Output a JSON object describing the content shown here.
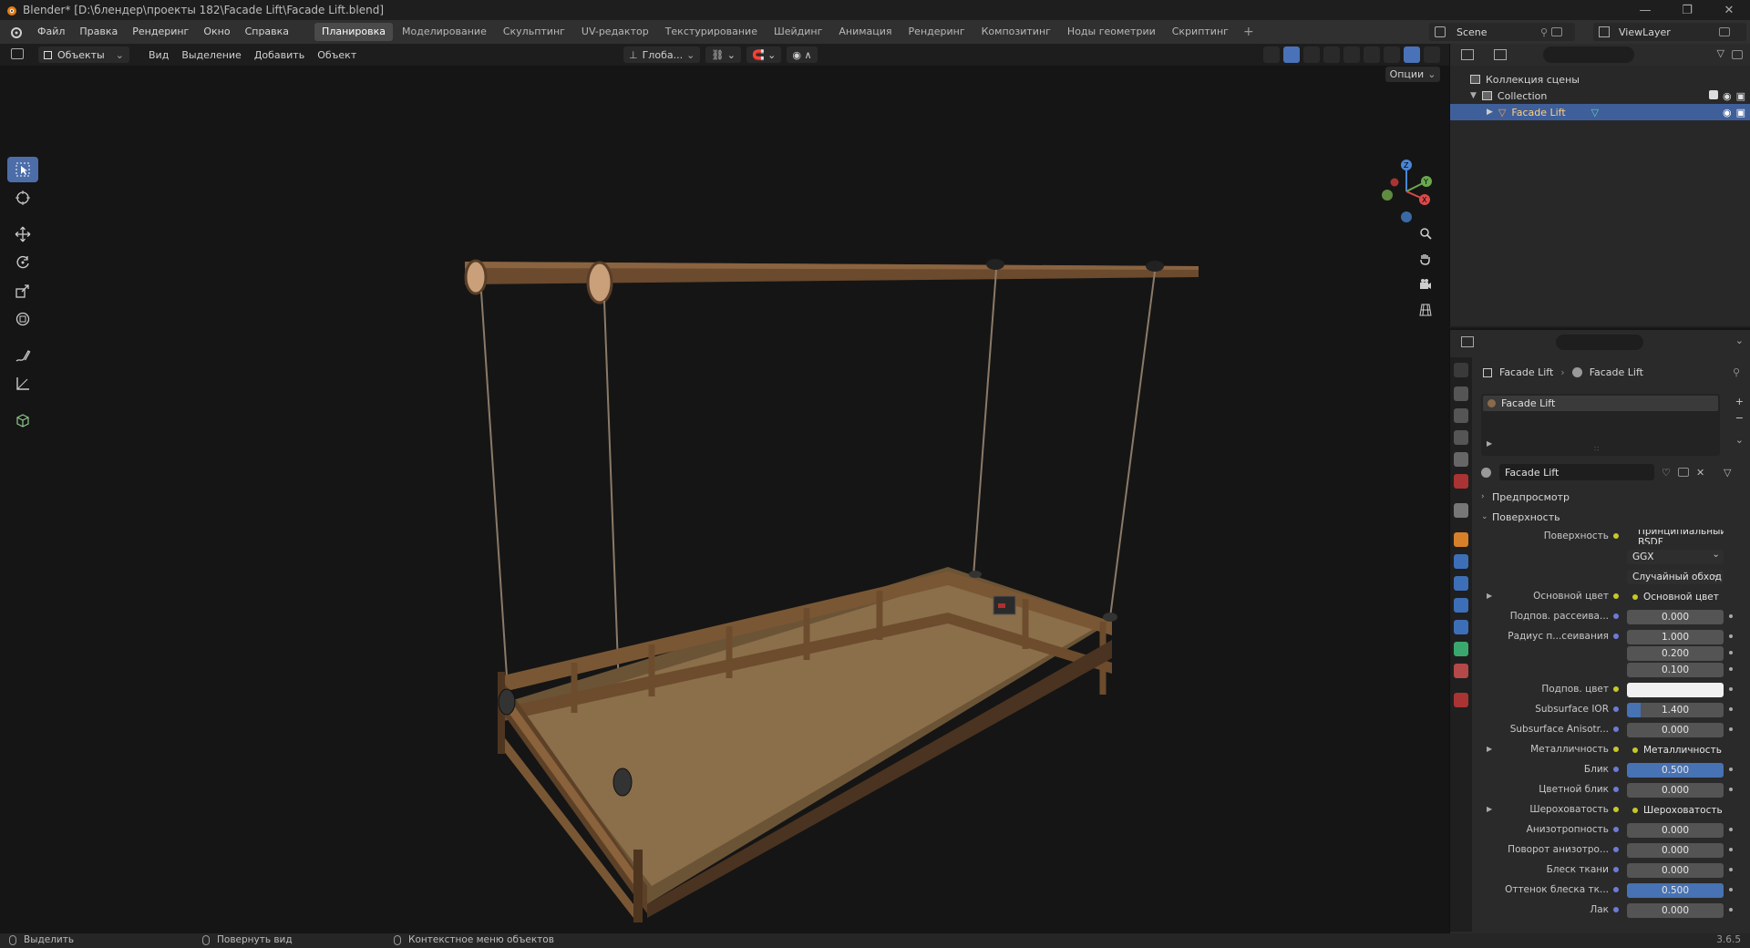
{
  "window": {
    "title": "Blender* [D:\\блендер\\проекты 182\\Facade Lift\\Facade Lift.blend]"
  },
  "menu": {
    "items": [
      "Файл",
      "Правка",
      "Рендеринг",
      "Окно",
      "Справка"
    ],
    "workspaces": [
      "Планировка",
      "Моделирование",
      "Скульптинг",
      "UV-редактор",
      "Текстурирование",
      "Шейдинг",
      "Анимация",
      "Рендеринг",
      "Композитинг",
      "Ноды геометрии",
      "Скриптинг"
    ],
    "active_workspace": "Планировка",
    "add_workspace": "+",
    "scene": "Scene",
    "view_layer": "ViewLayer"
  },
  "viewport_header": {
    "mode": "Объекты",
    "menus": [
      "Вид",
      "Выделение",
      "Добавить",
      "Объект"
    ],
    "transform_orientation": "Глоба...",
    "options": "Опции"
  },
  "outliner": {
    "root": "Коллекция сцены",
    "collection": "Collection",
    "object": "Facade Lift"
  },
  "properties": {
    "breadcrumb_object": "Facade Lift",
    "breadcrumb_material": "Facade Lift",
    "slot": "Facade Lift",
    "material_name": "Facade Lift",
    "panels": {
      "preview": "Предпросмотр",
      "surface": "Поверхность"
    },
    "rows": [
      {
        "label": "Поверхность",
        "value": "Принципиальный BSDF",
        "kind": "link"
      },
      {
        "label": "",
        "value": "GGX",
        "kind": "select"
      },
      {
        "label": "",
        "value": "Случайный обход",
        "kind": "select"
      },
      {
        "label": "Основной цвет",
        "value": "Основной цвет",
        "kind": "link",
        "expand": true
      },
      {
        "label": "Подпов. рассеива...",
        "value": "0.000",
        "kind": "num"
      },
      {
        "label": "Радиус п...сеивания",
        "value": "1.000",
        "kind": "num"
      },
      {
        "label": "",
        "value": "0.200",
        "kind": "num"
      },
      {
        "label": "",
        "value": "0.100",
        "kind": "num"
      },
      {
        "label": "Подпов. цвет",
        "value": "",
        "kind": "white"
      },
      {
        "label": "Subsurface IOR",
        "value": "1.400",
        "kind": "partial"
      },
      {
        "label": "Subsurface Anisotr...",
        "value": "0.000",
        "kind": "num"
      },
      {
        "label": "Металличность",
        "value": "Металличность",
        "kind": "link",
        "expand": true
      },
      {
        "label": "Блик",
        "value": "0.500",
        "kind": "blue"
      },
      {
        "label": "Цветной блик",
        "value": "0.000",
        "kind": "num"
      },
      {
        "label": "Шероховатость",
        "value": "Шероховатость",
        "kind": "link",
        "expand": true
      },
      {
        "label": "Анизотропность",
        "value": "0.000",
        "kind": "num"
      },
      {
        "label": "Поворот анизотро...",
        "value": "0.000",
        "kind": "num"
      },
      {
        "label": "Блеск ткани",
        "value": "0.000",
        "kind": "num"
      },
      {
        "label": "Оттенок блеска тк...",
        "value": "0.500",
        "kind": "blue"
      },
      {
        "label": "Лак",
        "value": "0.000",
        "kind": "num"
      }
    ]
  },
  "statusbar": {
    "select": "Выделить",
    "rotate": "Повернуть вид",
    "context": "Контекстное меню объектов",
    "version": "3.6.5"
  },
  "colors": {
    "accent": "#4772b3",
    "selected_row": "#3f5f9a",
    "viewport_bg": "#151515"
  }
}
